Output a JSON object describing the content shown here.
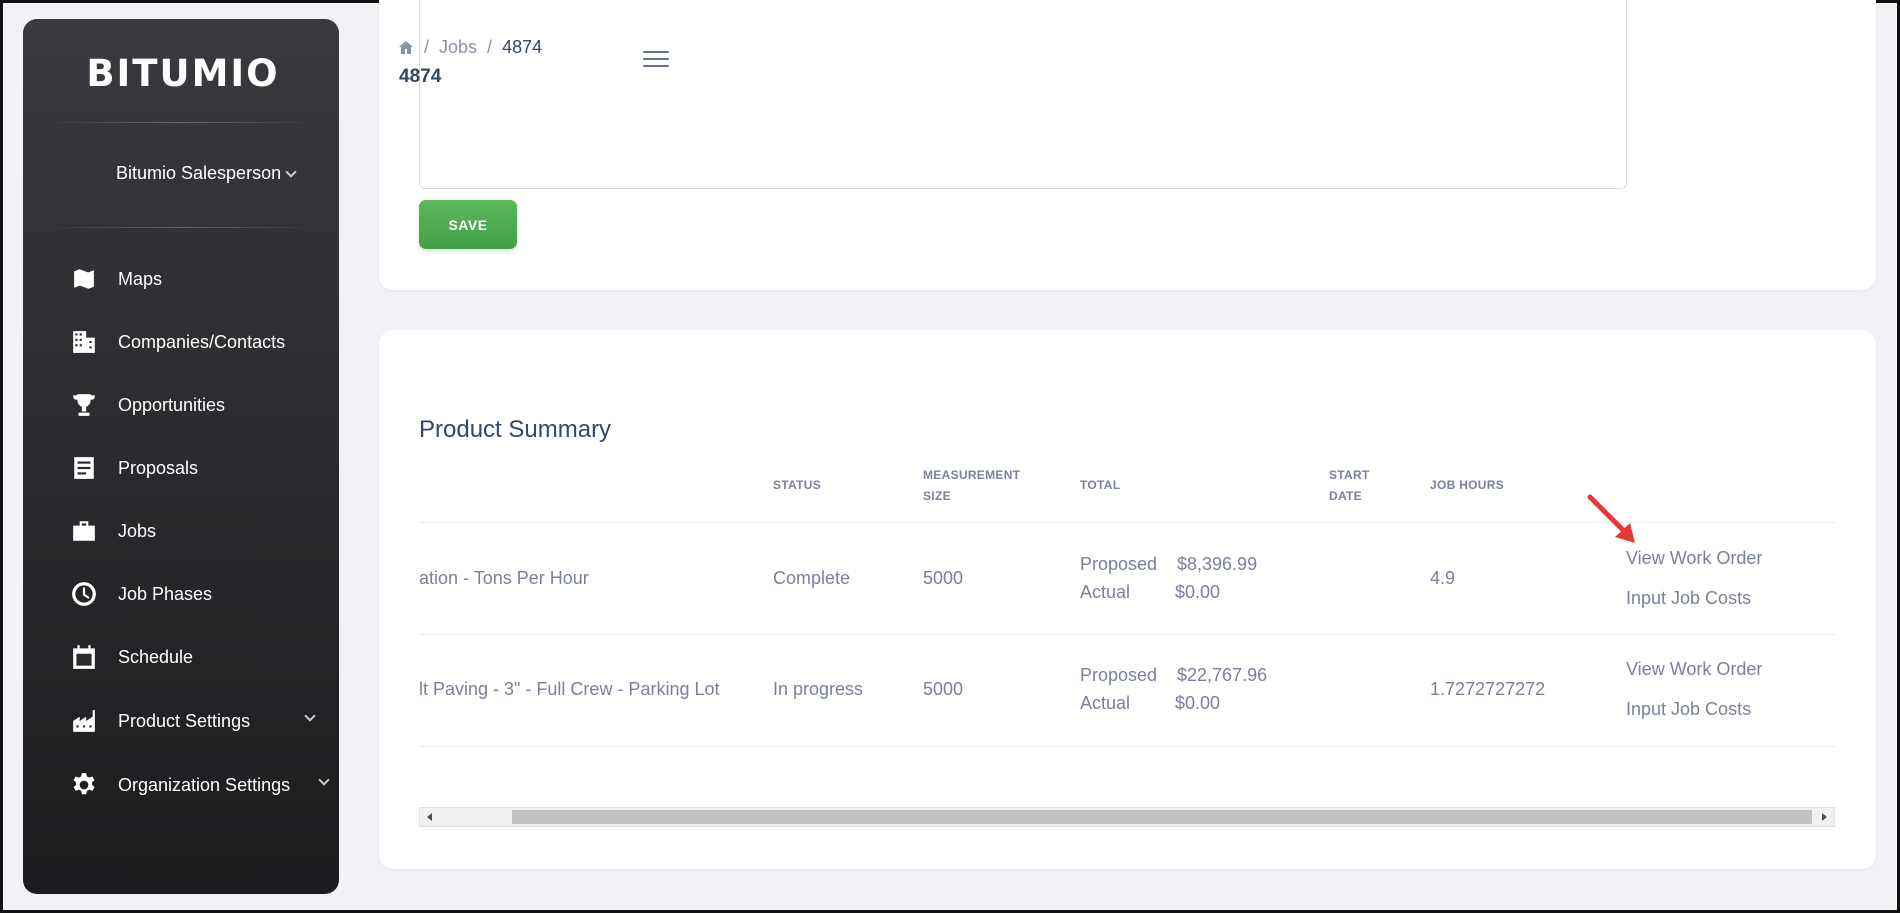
{
  "app": {
    "logo": "BITUMIO"
  },
  "user": {
    "name": "Bitumio Salesperson"
  },
  "sidebar": {
    "items": [
      {
        "label": "Maps",
        "icon": "map-icon"
      },
      {
        "label": "Companies/Contacts",
        "icon": "building-icon"
      },
      {
        "label": "Opportunities",
        "icon": "trophy-icon"
      },
      {
        "label": "Proposals",
        "icon": "document-icon"
      },
      {
        "label": "Jobs",
        "icon": "briefcase-icon"
      },
      {
        "label": "Job Phases",
        "icon": "clock-icon"
      },
      {
        "label": "Schedule",
        "icon": "calendar-icon"
      },
      {
        "label": "Product Settings",
        "icon": "factory-icon"
      },
      {
        "label": "Organization Settings",
        "icon": "gear-icon"
      }
    ]
  },
  "breadcrumb": {
    "home_icon": "home-icon",
    "section": "Jobs",
    "current": "4874"
  },
  "page": {
    "title": "4874"
  },
  "form": {
    "save_label": "SAVE"
  },
  "summary": {
    "title": "Product Summary",
    "columns": {
      "status": "STATUS",
      "measurement_1": "MEASUREMENT",
      "measurement_2": "SIZE",
      "total": "TOTAL",
      "start_1": "START",
      "start_2": "DATE",
      "job_hours": "JOB HOURS"
    },
    "rows": [
      {
        "product": "ation - Tons Per Hour",
        "status": "Complete",
        "measurement": "5000",
        "proposed_label": "Proposed",
        "proposed": "$8,396.99",
        "actual_label": "Actual",
        "actual": "$0.00",
        "job_hours": "4.9",
        "view_link": "View Work Order",
        "costs_link": "Input Job Costs"
      },
      {
        "product": "lt Paving - 3\" - Full Crew - Parking Lot",
        "status": "In progress",
        "measurement": "5000",
        "proposed_label": "Proposed",
        "proposed": "$22,767.96",
        "actual_label": "Actual",
        "actual": "$0.00",
        "job_hours": "1.7272727272",
        "view_link": "View Work Order",
        "costs_link": "Input Job Costs"
      }
    ]
  }
}
